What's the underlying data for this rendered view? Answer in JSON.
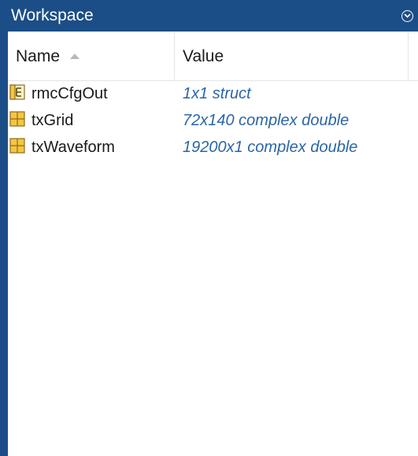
{
  "panel": {
    "title": "Workspace",
    "menu_icon": "chevron-down-circle-icon"
  },
  "columns": {
    "name_label": "Name",
    "value_label": "Value",
    "sort_icon": "sort-ascending-icon"
  },
  "variables": [
    {
      "name": "rmcCfgOut",
      "value": "1x1 struct",
      "icon": "struct-icon"
    },
    {
      "name": "txGrid",
      "value": "72x140 complex double",
      "icon": "matrix-icon"
    },
    {
      "name": "txWaveform",
      "value": "19200x1 complex double",
      "icon": "matrix-icon"
    }
  ],
  "colors": {
    "titlebar": "#1b4e86",
    "value_text": "#2a66a8",
    "icon_fill": "#f5c542"
  }
}
